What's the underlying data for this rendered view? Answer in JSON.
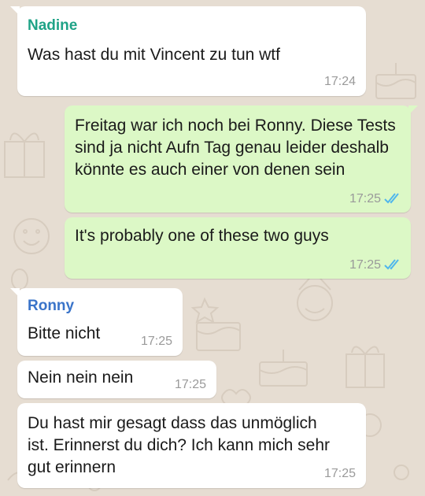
{
  "colors": {
    "chat_background": "#e6ddd2",
    "incoming_bubble": "#ffffff",
    "outgoing_bubble": "#dcf8c6",
    "sender_nadine": "#1fa387",
    "sender_ronny": "#3a74c9",
    "read_ticks": "#4fb6ec",
    "timestamp": "#9a9a9a"
  },
  "messages": [
    {
      "direction": "incoming",
      "sender": "Nadine",
      "text": "Was hast du mit Vincent zu tun wtf",
      "time": "17:24"
    },
    {
      "direction": "outgoing",
      "text": "Freitag war ich noch bei Ronny. Diese Tests sind ja nicht Aufn Tag genau leider deshalb könnte es auch einer von denen sein",
      "time": "17:25",
      "status": "read",
      "status_icon": "double-check-icon"
    },
    {
      "direction": "outgoing",
      "text": "It's probably one of these two guys",
      "time": "17:25",
      "status": "read",
      "status_icon": "double-check-icon"
    },
    {
      "direction": "incoming",
      "sender": "Ronny",
      "text": "Bitte nicht",
      "time": "17:25"
    },
    {
      "direction": "incoming",
      "text": "Nein nein nein",
      "time": "17:25"
    },
    {
      "direction": "incoming",
      "text": "Du hast mir gesagt dass das unmöglich ist. Erinnerst du dich? Ich kann mich sehr gut erinnern",
      "time": "17:25"
    }
  ]
}
